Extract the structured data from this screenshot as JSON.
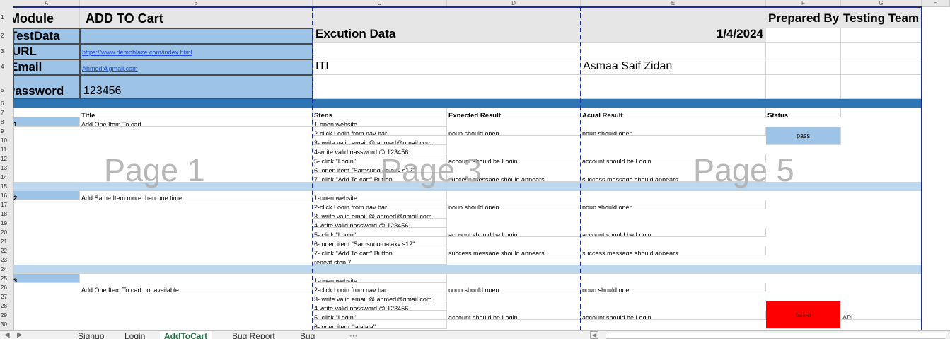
{
  "columns": [
    "A",
    "B",
    "C",
    "D",
    "E",
    "F",
    "G",
    "H"
  ],
  "rows": [
    "1",
    "2",
    "3",
    "4",
    "5",
    "6",
    "7",
    "8",
    "9",
    "10",
    "11",
    "12",
    "13",
    "14",
    "15",
    "16",
    "17",
    "18",
    "19",
    "20",
    "21",
    "22",
    "23",
    "24",
    "25",
    "26",
    "27",
    "28",
    "29",
    "30"
  ],
  "header": {
    "module_label": "Module",
    "module_value": "ADD TO Cart",
    "testdata_label": "TestData",
    "url_label": "URL",
    "url_value": "https://www.demoblaze.com/index.html",
    "email_label": "Email",
    "email_value": "Ahmed@gmail.com",
    "password_label": "Password",
    "password_value": "123456",
    "execution_label": "Excution Data",
    "date": "1/4/2024",
    "prepared_by_label": "Prepared By",
    "prepared_by_value": "Testing Team",
    "org": "ITI",
    "tester": "Asmaa Saif Zidan"
  },
  "table_headers": {
    "title": "Title",
    "steps": "Steps",
    "expected": "Expected Result",
    "actual": "Acual  Result",
    "status": "Status"
  },
  "test_cases": [
    {
      "id": "1",
      "title": "Add One Item To cart",
      "status": "pass"
    },
    {
      "id": "2",
      "title": "Add Same Item more than one time"
    },
    {
      "id": "3",
      "title": "Add One Item To cart not available",
      "status": "failed",
      "note": "API"
    }
  ],
  "steps": {
    "open": "1-open website",
    "login_nav": "2-click Login from nav bar",
    "email": "3- write valid email @ ahmed@gmail.com",
    "password": "4-write valid password @ 123456",
    "click_login": "5- click \"Login\"",
    "open_item": "6- open item \"Samsung galaxy s12\"",
    "add_cart": "7- click \"Add To cart\" Button",
    "repeat": "repeat step 7",
    "open_item_lala": "6- open item \"lalalala\""
  },
  "results": {
    "popup": "poup should open",
    "login": "account should be Login",
    "success": "success message should appears"
  },
  "watermarks": [
    "Page 1",
    "Page 3",
    "Page 5"
  ],
  "tabs": [
    "Signup",
    "Login",
    "AddToCart",
    "Bug Report",
    "Bug"
  ],
  "active_tab": "AddToCart",
  "colors": {
    "accent_green": "#217346",
    "failed_red": "#ff0000",
    "header_blue": "#9dc3e6",
    "section_blue": "#2e75b6"
  }
}
